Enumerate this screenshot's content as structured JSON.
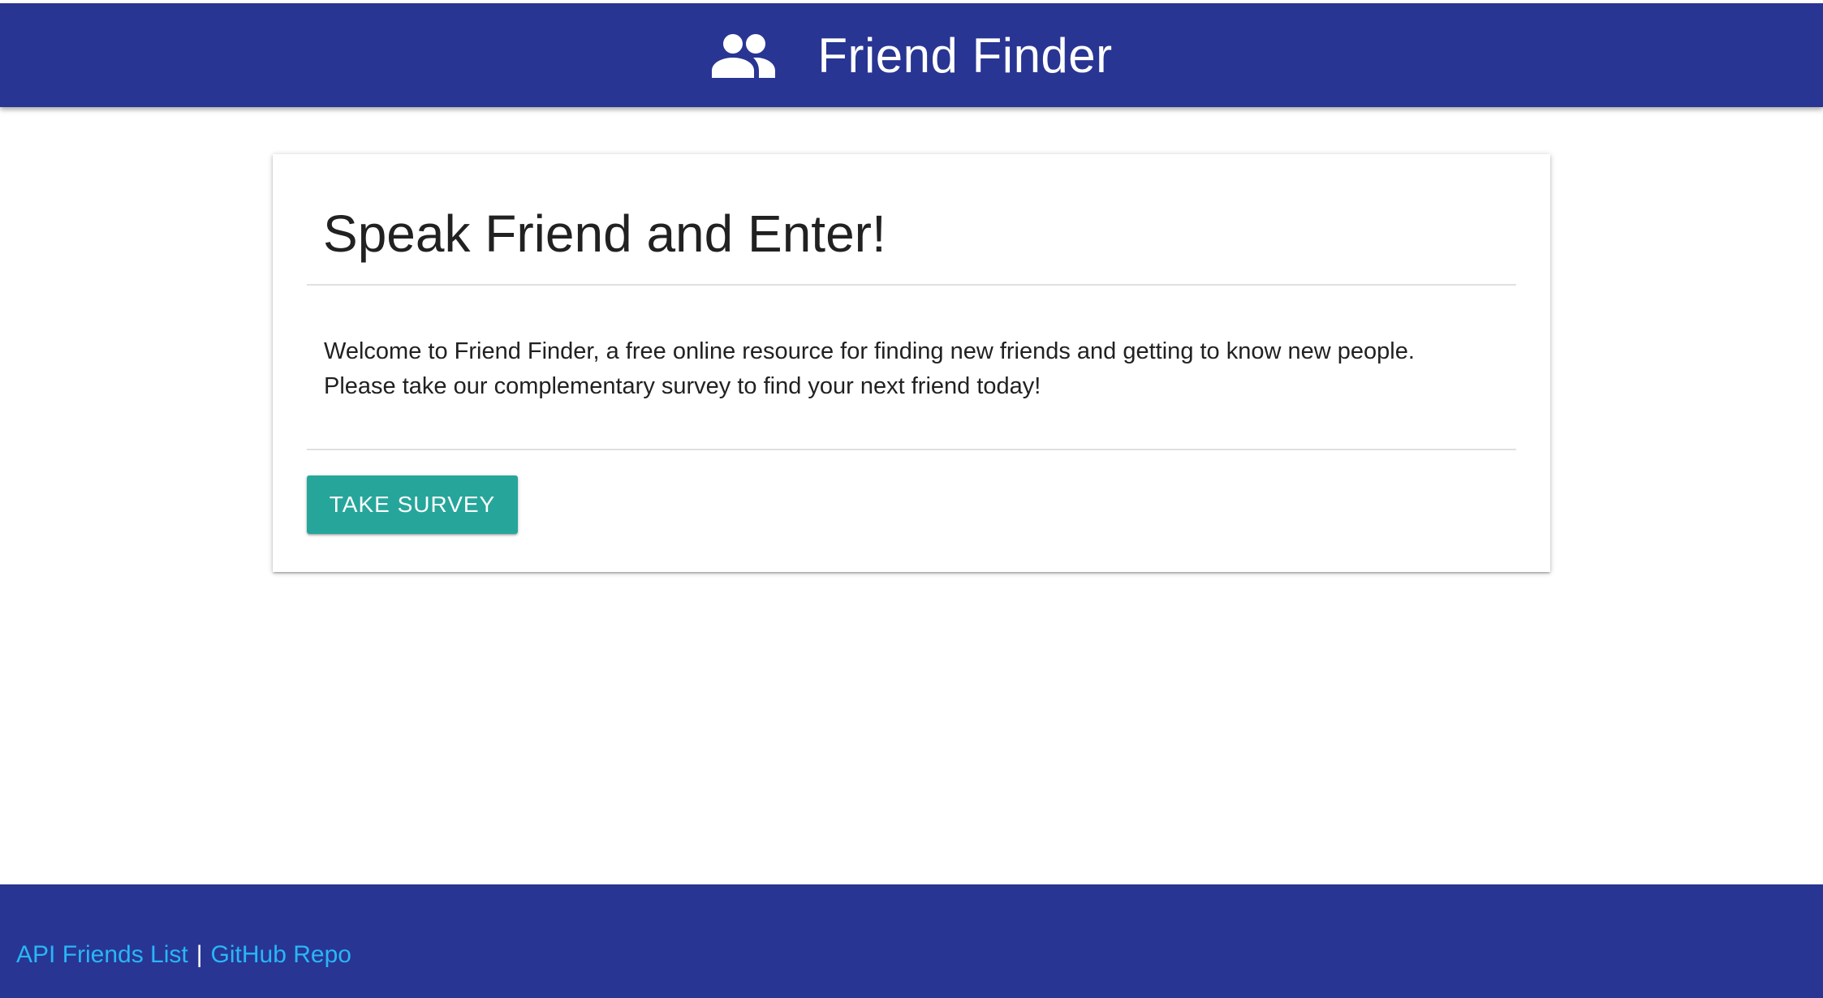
{
  "header": {
    "title": "Friend Finder",
    "icon": "people-icon"
  },
  "card": {
    "title": "Speak Friend and Enter!",
    "line1": "Welcome to Friend Finder, a free online resource for finding new friends and getting to know new people.",
    "line2": "Please take our complementary survey to find your next friend today!",
    "button_label": "TAKE SURVEY"
  },
  "footer": {
    "link1": "API Friends List",
    "separator": "|",
    "link2": "GitHub Repo"
  },
  "colors": {
    "navbar": "#283593",
    "button": "#26a69a",
    "link": "#29b6f6"
  }
}
